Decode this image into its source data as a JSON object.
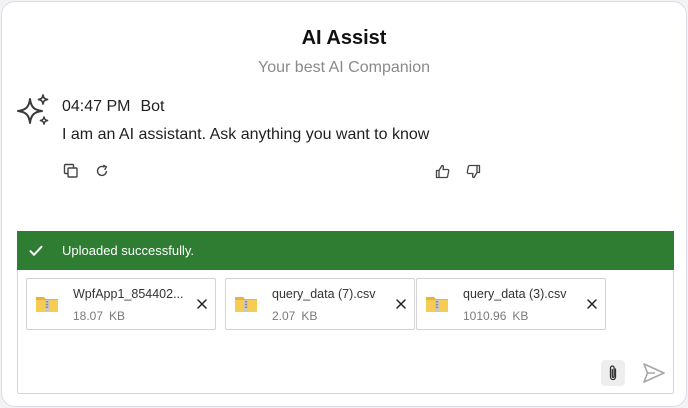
{
  "header": {
    "title": "AI Assist",
    "subtitle": "Your best AI Companion"
  },
  "message": {
    "time": "04:47 PM",
    "sender": "Bot",
    "text": "I am an AI assistant. Ask anything you want to know",
    "icons": [
      "sparkle-icon",
      "copy-icon",
      "refresh-icon",
      "thumbs-up-icon",
      "thumbs-down-icon"
    ]
  },
  "upload": {
    "banner_text": "Uploaded successfully.",
    "banner_color": "#2e7d32",
    "files": [
      {
        "name": "WpfApp1_854402...",
        "size": "18.07",
        "unit": "KB"
      },
      {
        "name": "query_data (7).csv",
        "size": "2.07",
        "unit": "KB"
      },
      {
        "name": "query_data (3).csv",
        "size": "1010.96",
        "unit": "KB"
      }
    ]
  },
  "composer": {
    "icons": [
      "paperclip-icon",
      "send-icon"
    ]
  }
}
